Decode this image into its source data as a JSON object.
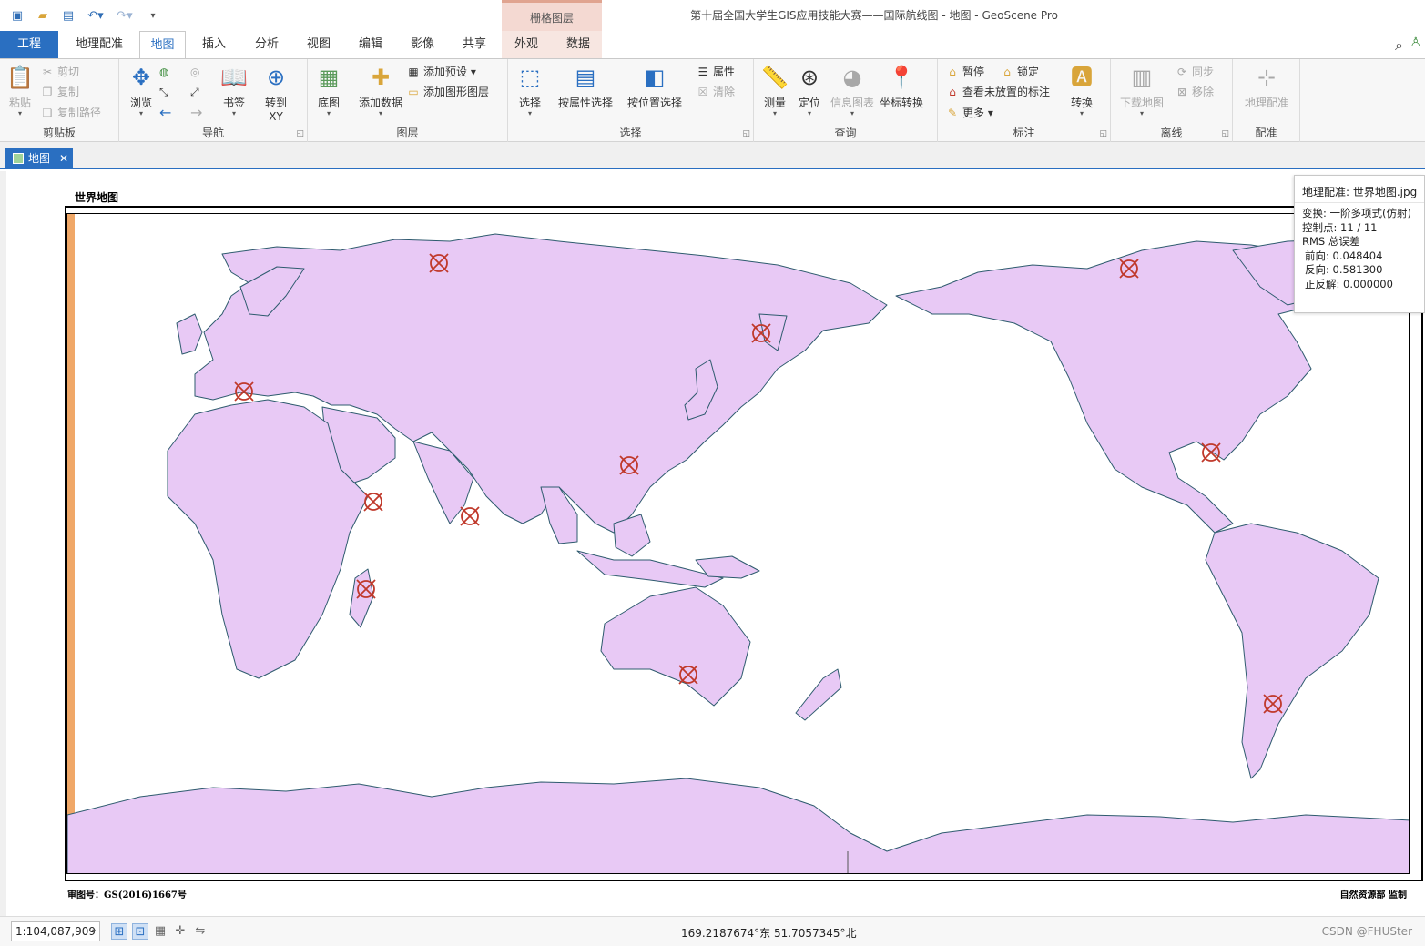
{
  "window": {
    "title": "第十届全国大学生GIS应用技能大赛——国际航线图 - 地图 - GeoScene Pro",
    "contextual_tab_header": "栅格图层"
  },
  "tabs": [
    {
      "label": "工程"
    },
    {
      "label": "地理配准"
    },
    {
      "label": "地图"
    },
    {
      "label": "插入"
    },
    {
      "label": "分析"
    },
    {
      "label": "视图"
    },
    {
      "label": "编辑"
    },
    {
      "label": "影像"
    },
    {
      "label": "共享"
    },
    {
      "label": "外观"
    },
    {
      "label": "数据"
    }
  ],
  "ribbon": {
    "clipboard": {
      "label": "剪贴板",
      "paste": "粘贴",
      "cut": "剪切",
      "copy": "复制",
      "copy_path": "复制路径"
    },
    "navigate": {
      "label": "导航",
      "explore": "浏览",
      "bookmarks": "书签",
      "goto_xy": "转到\nXY",
      "goto_l1": "转到",
      "goto_l2": "XY"
    },
    "layer": {
      "label": "图层",
      "basemap": "底图",
      "add_data": "添加数据",
      "add_preset": "添加预设",
      "add_graphics": "添加图形图层"
    },
    "selection": {
      "label": "选择",
      "select": "选择",
      "select_by_attr": "按属性选择",
      "select_by_loc": "按位置选择",
      "attributes": "属性",
      "clear": "清除"
    },
    "inquiry": {
      "label": "查询",
      "measure": "测量",
      "locate": "定位",
      "infographics": "信息图表",
      "convert_coords": "坐标转换"
    },
    "labeling": {
      "label": "标注",
      "pause": "暂停",
      "lock": "锁定",
      "view_unplaced": "查看未放置的标注",
      "more": "更多",
      "convert": "转换"
    },
    "offline": {
      "label": "离线",
      "download_map": "下载地图",
      "sync": "同步",
      "remove": "移除"
    },
    "registration": {
      "label": "配准",
      "georeference": "地理配准"
    }
  },
  "document_tab": {
    "label": "地图"
  },
  "layout": {
    "title": "世界地图",
    "approval_no": "审图号：GS(2016)1667号",
    "producer": "自然资源部  监制"
  },
  "georef_panel": {
    "header": "地理配准: 世界地图.jpg",
    "transform": "变换:   一阶多项式(仿射)",
    "control_points": "控制点:   11 / 11",
    "rms_title": "RMS 总误差",
    "forward": "前向:   0.048404",
    "inverse": "反向:   0.581300",
    "forward_inverse": "正反解:   0.000000"
  },
  "status": {
    "scale": "1:104,087,909",
    "coordinates": "169.2187674°东 51.7057345°北",
    "watermark": "CSDN @FHUSter"
  },
  "colors": {
    "land": "#e8c9f5",
    "coast": "#2e5b6e",
    "control_point": "#c0392b",
    "accent": "#2a6fc1",
    "antarctic_edge": "#f0a868"
  },
  "icons": {
    "control_point": "crossed-circle-marker"
  }
}
